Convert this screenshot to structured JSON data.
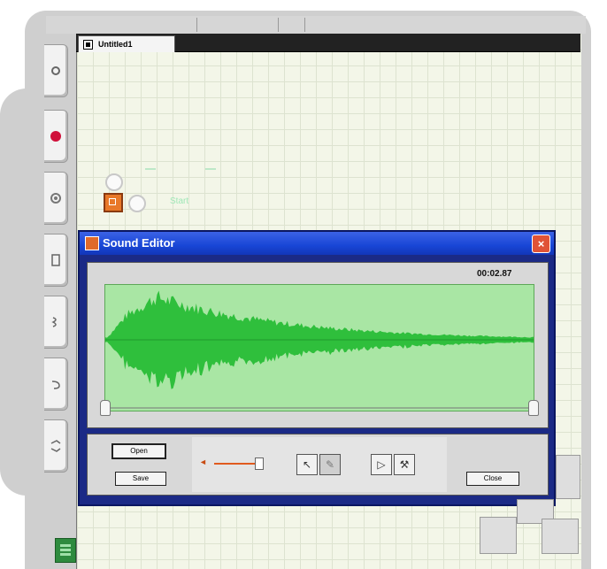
{
  "document": {
    "tab_title": "Untitled1"
  },
  "node": {
    "label": "Start"
  },
  "sound_editor": {
    "title": "Sound Editor",
    "close_glyph": "×",
    "time": "00:02.87",
    "waveform_color": "#2fbf3c",
    "open_label": "Open",
    "save_label": "Save",
    "close_label": "Close",
    "volume_icon": "◄",
    "tools": [
      "cursor-icon",
      "pen-icon",
      "play-icon",
      "wrench-icon"
    ]
  },
  "colors": {
    "title_bar": "#1846d6",
    "dialog_border": "#1b2a86",
    "wave_background": "#a9e6a4",
    "accent": "#e05a1e"
  }
}
